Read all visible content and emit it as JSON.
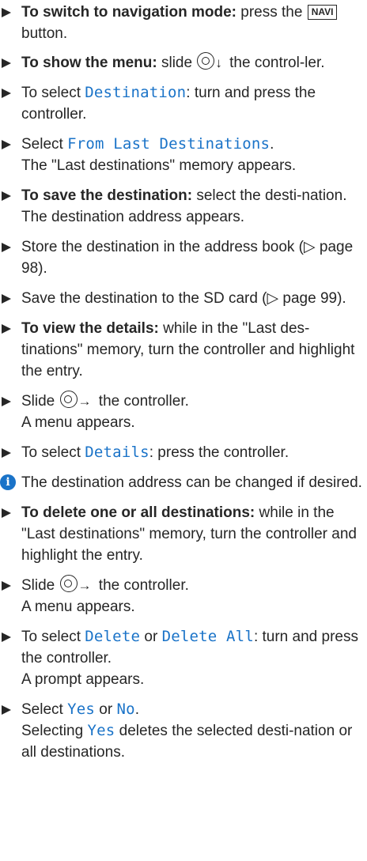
{
  "items": [
    {
      "bold": "To switch to navigation mode:",
      "t1": " press the",
      "key": "NAVI",
      "t2": " button."
    },
    {
      "bold": "To show the menu:",
      "t1": " slide",
      "arrow": "↓",
      "t2": " the control-ler."
    },
    {
      "t1": "To select ",
      "disp": "Destination",
      "t2": ": turn and press the controller."
    },
    {
      "t1": "Select ",
      "disp": "From Last Destinations",
      "t2": ".",
      "line2": "The \"Last destinations\" memory appears."
    },
    {
      "bold": "To save the destination:",
      "t1": " select the desti-nation.",
      "line2": "The destination address appears."
    },
    {
      "t1": "Store the destination in the address book (▷ page 98)."
    },
    {
      "t1": "Save the destination to the SD card (▷ page 99)."
    },
    {
      "bold": "To view the details:",
      "t1": " while in the \"Last des-tinations\" memory, turn the controller and highlight the entry."
    },
    {
      "t1": "Slide",
      "arrow": "→",
      "t2": " the controller.",
      "line2": "A menu appears."
    },
    {
      "t1": "To select ",
      "disp": "Details",
      "t2": ": press the controller."
    },
    {
      "note": "The destination address can be changed if desired."
    },
    {
      "bold": "To delete one or all destinations:",
      "t1": " while in the \"Last destinations\" memory, turn the controller and highlight the entry."
    },
    {
      "t1": "Slide",
      "arrow": "→",
      "t2": " the controller.",
      "line2": "A menu appears."
    },
    {
      "t1": "To select ",
      "disp": "Delete",
      "t2": " or ",
      "disp2": "Delete All",
      "t3": ": turn and press the controller.",
      "line2": "A prompt appears."
    },
    {
      "t1": "Select ",
      "disp": "Yes",
      "t2": " or ",
      "disp2": "No",
      "t3": ".",
      "line2a": "Selecting ",
      "disp3": "Yes",
      "line2b": " deletes the selected desti-nation or all destinations."
    }
  ],
  "colors": {
    "text": "#262626",
    "display": "#1a73c8"
  },
  "icons": {
    "bullet": "triangle-bullet-icon",
    "controller": "controller-icon",
    "info": "info-icon"
  }
}
